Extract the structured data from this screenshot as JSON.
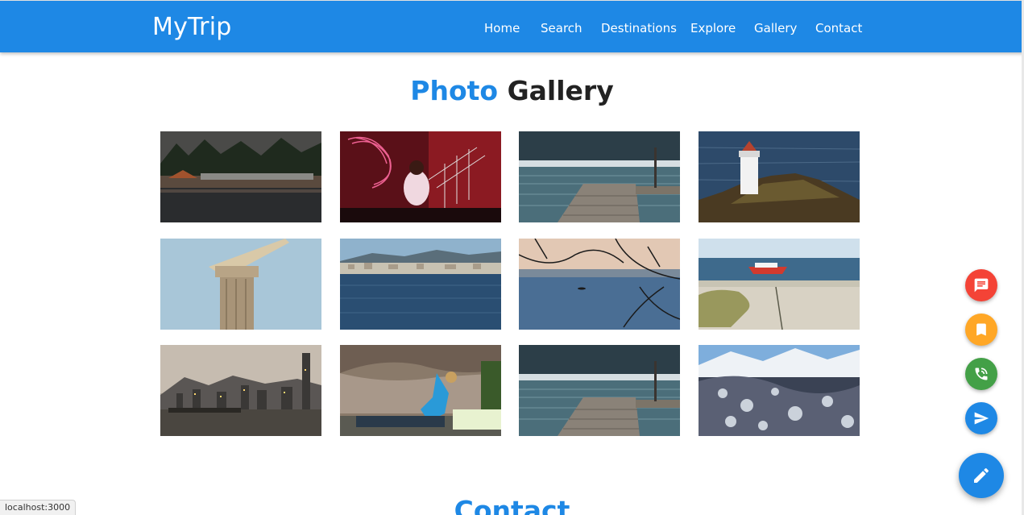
{
  "navbar": {
    "brand": "MyTrip",
    "links": [
      {
        "label": "Home"
      },
      {
        "label": "Search"
      },
      {
        "label": "Destinations"
      },
      {
        "label": "Explore"
      },
      {
        "label": "Gallery"
      },
      {
        "label": "Contact"
      }
    ],
    "color": "#1e88e5"
  },
  "gallery": {
    "title_accent": "Photo",
    "title_rest": "Gallery",
    "photos": [
      {
        "name": "beach-huts-night"
      },
      {
        "name": "light-painting-person"
      },
      {
        "name": "lake-pier"
      },
      {
        "name": "lighthouse-cliff"
      },
      {
        "name": "stone-pillar"
      },
      {
        "name": "coastal-town"
      },
      {
        "name": "lake-branches-sunset"
      },
      {
        "name": "beach-boats"
      },
      {
        "name": "city-skyline-harbor"
      },
      {
        "name": "rock-climber"
      },
      {
        "name": "lake-pier"
      },
      {
        "name": "snowy-mountain-valley"
      }
    ]
  },
  "contact": {
    "title": "Contact"
  },
  "fab": {
    "items": [
      {
        "icon": "message-icon",
        "color": "#f44336"
      },
      {
        "icon": "bookmark-icon",
        "color": "#ffa726"
      },
      {
        "icon": "phone-icon",
        "color": "#43a047"
      },
      {
        "icon": "send-icon",
        "color": "#1e88e5"
      }
    ],
    "main_icon": "edit-icon",
    "main_color": "#1e88e5"
  },
  "status": {
    "url": "localhost:3000"
  }
}
